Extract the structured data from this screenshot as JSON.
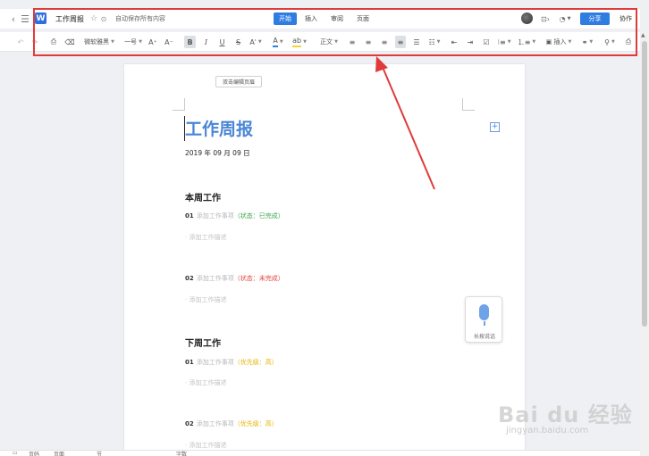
{
  "titlebar": {
    "back_icon": "chevron-left-icon",
    "menu_icon": "hamburger-icon",
    "app_logo_letter": "W",
    "doc_title": "工作周报",
    "autosave": "自动保存所有内容",
    "tabs": [
      {
        "label": "开始",
        "active": true
      },
      {
        "label": "插入",
        "active": false
      },
      {
        "label": "审阅",
        "active": false
      },
      {
        "label": "页面",
        "active": false
      }
    ],
    "share_label": "分享",
    "collab_label": "协作",
    "accent_color": "#2f7de1"
  },
  "toolbar": {
    "font_name": "微软雅黑",
    "font_size": "一号",
    "style_name": "正文",
    "insert_label": "插入"
  },
  "document": {
    "header_edit": "双击编辑页眉",
    "title": "工作周报",
    "title_color": "#4a86d6",
    "date": "2019 年 09 月 09 日",
    "sections": [
      {
        "title": "本周工作",
        "items": [
          {
            "num": "01",
            "text": "添加工作事项",
            "status": "（状态：已完成）",
            "desc": "· 添加工作描述"
          },
          {
            "num": "02",
            "text": "添加工作事项",
            "status": "（状态：未完成）",
            "desc": "· 添加工作描述"
          }
        ]
      },
      {
        "title": "下周工作",
        "items": [
          {
            "num": "01",
            "text": "添加工作事项",
            "status": "（优先级：高）",
            "desc": "· 添加工作描述"
          },
          {
            "num": "02",
            "text": "添加工作事项",
            "status": "（优先级：高）",
            "desc": "· 添加工作描述"
          }
        ]
      }
    ]
  },
  "voice": {
    "label": "长按说话"
  },
  "watermark": {
    "text": "Bai du 经验",
    "sub": "jingyan.baidu.com"
  },
  "statusbar": {
    "items": [
      "页码",
      "页面",
      "节",
      "字数"
    ]
  },
  "annotation_color": "#e03b3b"
}
